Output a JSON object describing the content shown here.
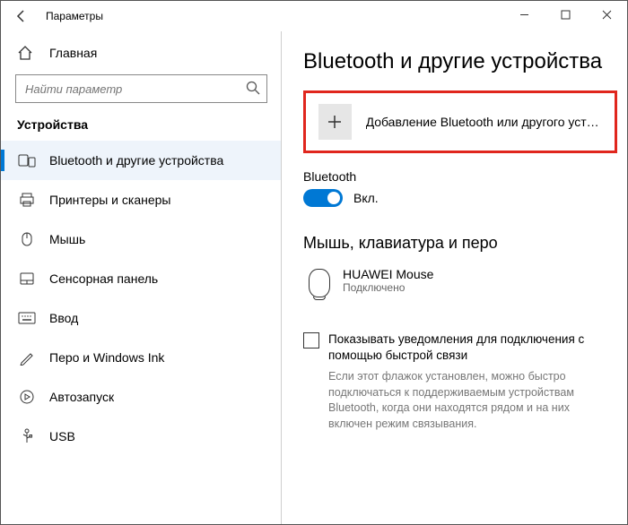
{
  "window": {
    "title": "Параметры"
  },
  "sidebar": {
    "home_label": "Главная",
    "search_placeholder": "Найти параметр",
    "category": "Устройства",
    "items": [
      {
        "label": "Bluetooth и другие устройства",
        "icon": "bluetooth-devices",
        "active": true
      },
      {
        "label": "Принтеры и сканеры",
        "icon": "printer"
      },
      {
        "label": "Мышь",
        "icon": "mouse"
      },
      {
        "label": "Сенсорная панель",
        "icon": "touchpad"
      },
      {
        "label": "Ввод",
        "icon": "keyboard"
      },
      {
        "label": "Перо и Windows Ink",
        "icon": "pen"
      },
      {
        "label": "Автозапуск",
        "icon": "autoplay"
      },
      {
        "label": "USB",
        "icon": "usb"
      }
    ]
  },
  "content": {
    "page_title": "Bluetooth и другие устройства",
    "add_device_label": "Добавление Bluetooth или другого устройс...",
    "bluetooth_section_label": "Bluetooth",
    "bluetooth_toggle_state": "Вкл.",
    "subhead": "Мышь, клавиатура и перо",
    "device": {
      "name": "HUAWEI  Mouse",
      "status": "Подключено"
    },
    "checkbox_label": "Показывать уведомления для подключения с помощью быстрой связи",
    "checkbox_desc": "Если этот флажок установлен, можно быстро подключаться к поддерживаемым устройствам Bluetooth, когда они находятся рядом и на них включен режим связывания."
  }
}
